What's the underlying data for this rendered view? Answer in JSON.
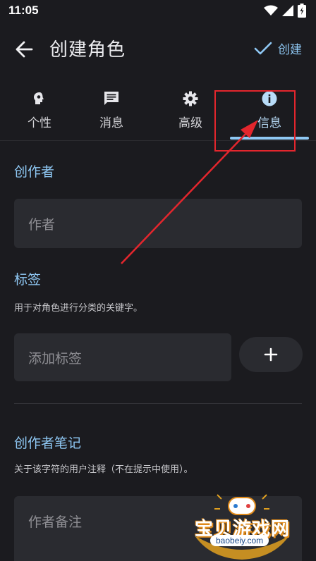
{
  "status_bar": {
    "time": "11:05"
  },
  "header": {
    "title": "创建角色",
    "create_label": "创建"
  },
  "tabs": [
    {
      "label": "个性",
      "icon": "brain-icon"
    },
    {
      "label": "消息",
      "icon": "message-icon"
    },
    {
      "label": "高级",
      "icon": "gear-icon"
    },
    {
      "label": "信息",
      "icon": "info-icon",
      "active": true
    }
  ],
  "creator": {
    "title": "创作者",
    "placeholder": "作者"
  },
  "tags": {
    "title": "标签",
    "hint": "用于对角色进行分类的关键字。",
    "placeholder": "添加标签",
    "add_label": "+"
  },
  "creator_notes": {
    "title": "创作者笔记",
    "hint": "关于该字符的用户注释（不在提示中使用）。",
    "placeholder": "作者备注"
  },
  "watermark": {
    "text": "宝贝游戏网",
    "url": "baobeiy.com"
  },
  "colors": {
    "accent": "#8fc8f4",
    "background": "#1b1b1f",
    "field": "#2a2b30",
    "annotation": "#e3262d"
  }
}
